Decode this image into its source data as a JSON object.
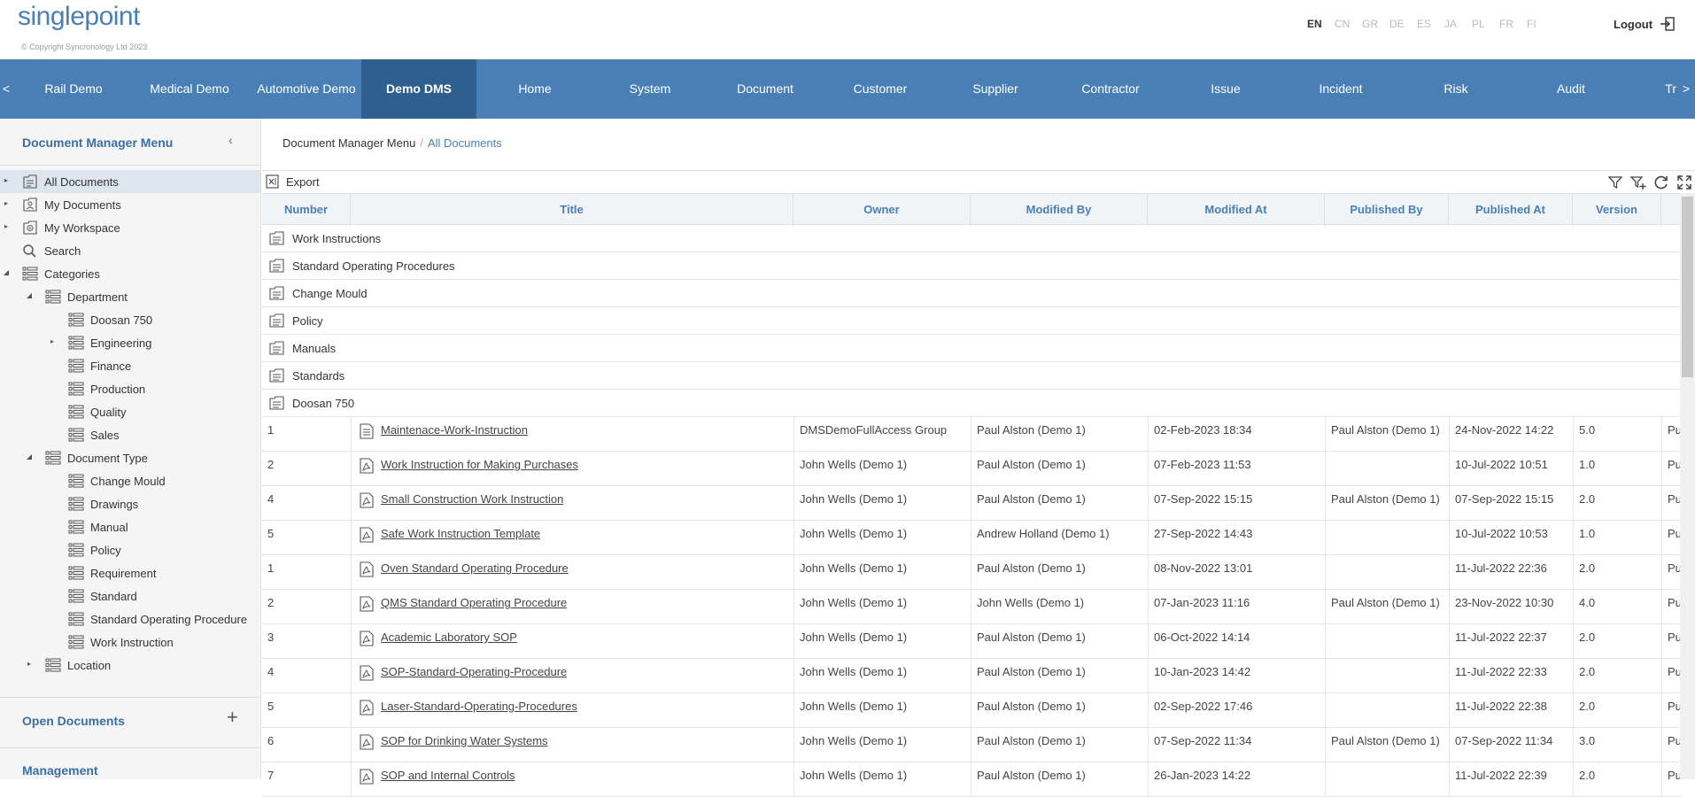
{
  "header": {
    "logo": "singlepoint",
    "copyright": "© Copyright Syncronology Ltd 2023",
    "languages": [
      "EN",
      "CN",
      "GR",
      "DE",
      "ES",
      "JA",
      "PL",
      "FR",
      "FI"
    ],
    "active_language": "EN",
    "logout_label": "Logout"
  },
  "nav": {
    "prev": "<",
    "next": ">",
    "items": [
      "Rail Demo",
      "Medical Demo",
      "Automotive Demo",
      "Demo DMS",
      "Home",
      "System",
      "Document",
      "Customer",
      "Supplier",
      "Contractor",
      "Issue",
      "Incident",
      "Risk",
      "Audit",
      "Tr"
    ],
    "active": "Demo DMS"
  },
  "sidebar": {
    "title": "Document Manager Menu",
    "collapse": "‹",
    "tree": [
      {
        "label": "All Documents",
        "toggle": "▸",
        "icon": "folder-list-icon",
        "selected": true
      },
      {
        "label": "My Documents",
        "toggle": "▸",
        "icon": "person-doc-icon"
      },
      {
        "label": "My Workspace",
        "toggle": "▸",
        "icon": "workspace-doc-icon"
      },
      {
        "label": "Search",
        "toggle": "",
        "icon": "search-icon"
      },
      {
        "label": "Categories",
        "toggle": "◢",
        "icon": "list-icon"
      },
      {
        "label": "Department",
        "toggle": "◢",
        "icon": "list-icon"
      },
      {
        "label": "Doosan 750",
        "toggle": "",
        "icon": "list-icon"
      },
      {
        "label": "Engineering",
        "toggle": "▸",
        "icon": "list-icon"
      },
      {
        "label": "Finance",
        "toggle": "",
        "icon": "list-icon"
      },
      {
        "label": "Production",
        "toggle": "",
        "icon": "list-icon"
      },
      {
        "label": "Quality",
        "toggle": "",
        "icon": "list-icon"
      },
      {
        "label": "Sales",
        "toggle": "",
        "icon": "list-icon"
      },
      {
        "label": "Document Type",
        "toggle": "◢",
        "icon": "list-icon"
      },
      {
        "label": "Change Mould",
        "toggle": "",
        "icon": "list-icon"
      },
      {
        "label": "Drawings",
        "toggle": "",
        "icon": "list-icon"
      },
      {
        "label": "Manual",
        "toggle": "",
        "icon": "list-icon"
      },
      {
        "label": "Policy",
        "toggle": "",
        "icon": "list-icon"
      },
      {
        "label": "Requirement",
        "toggle": "",
        "icon": "list-icon"
      },
      {
        "label": "Standard",
        "toggle": "",
        "icon": "list-icon"
      },
      {
        "label": "Standard Operating Procedure",
        "toggle": "",
        "icon": "list-icon"
      },
      {
        "label": "Work Instruction",
        "toggle": "",
        "icon": "list-icon"
      },
      {
        "label": "Location",
        "toggle": "▸",
        "icon": "list-icon"
      }
    ],
    "open_documents": "Open Documents",
    "add": "+",
    "management": "Management"
  },
  "breadcrumb": {
    "root": "Document Manager Menu",
    "separator": "/",
    "current": "All Documents"
  },
  "toolbar": {
    "export": "Export"
  },
  "grid": {
    "columns": [
      "Number",
      "Title",
      "Owner",
      "Modified By",
      "Modified At",
      "Published By",
      "Published At",
      "Version"
    ],
    "folders": [
      "Work Instructions",
      "Standard Operating Procedures",
      "Change Mould",
      "Policy",
      "Manuals",
      "Standards",
      "Doosan 750"
    ],
    "rows": [
      {
        "number": "1",
        "title": "Maintenace-Work-Instruction",
        "icon": "document-icon",
        "owner": "DMSDemoFullAccess Group",
        "modified_by": "Paul Alston (Demo 1)",
        "modified_at": "02-Feb-2023 18:34",
        "published_by": "Paul Alston (Demo 1)",
        "published_at": "24-Nov-2022 14:22",
        "version": "5.0",
        "status": "Pu"
      },
      {
        "number": "2",
        "title": "Work Instruction for Making Purchases",
        "icon": "pdf-icon",
        "owner": "John Wells (Demo 1)",
        "modified_by": "Paul Alston (Demo 1)",
        "modified_at": "07-Feb-2023 11:53",
        "published_by": "",
        "published_at": "10-Jul-2022 10:51",
        "version": "1.0",
        "status": "Pu"
      },
      {
        "number": "4",
        "title": "Small Construction Work Instruction",
        "icon": "pdf-icon",
        "owner": "John Wells (Demo 1)",
        "modified_by": "Paul Alston (Demo 1)",
        "modified_at": "07-Sep-2022 15:15",
        "published_by": "Paul Alston (Demo 1)",
        "published_at": "07-Sep-2022 15:15",
        "version": "2.0",
        "status": "Pu"
      },
      {
        "number": "5",
        "title": "Safe Work Instruction Template",
        "icon": "pdf-icon",
        "owner": "John Wells (Demo 1)",
        "modified_by": "Andrew Holland (Demo 1)",
        "modified_at": "27-Sep-2022 14:43",
        "published_by": "",
        "published_at": "10-Jul-2022 10:53",
        "version": "1.0",
        "status": "Pu"
      },
      {
        "number": "1",
        "title": "Oven Standard Operating Procedure",
        "icon": "pdf-icon",
        "owner": "John Wells (Demo 1)",
        "modified_by": "Paul Alston (Demo 1)",
        "modified_at": "08-Nov-2022 13:01",
        "published_by": "",
        "published_at": "11-Jul-2022 22:36",
        "version": "2.0",
        "status": "Pu"
      },
      {
        "number": "2",
        "title": "QMS Standard Operating Procedure",
        "icon": "pdf-icon",
        "owner": "John Wells (Demo 1)",
        "modified_by": "John Wells (Demo 1)",
        "modified_at": "07-Jan-2023 11:16",
        "published_by": "Paul Alston (Demo 1)",
        "published_at": "23-Nov-2022 10:30",
        "version": "4.0",
        "status": "Pu"
      },
      {
        "number": "3",
        "title": "Academic Laboratory SOP",
        "icon": "pdf-icon",
        "owner": "John Wells (Demo 1)",
        "modified_by": "Paul Alston (Demo 1)",
        "modified_at": "06-Oct-2022 14:14",
        "published_by": "",
        "published_at": "11-Jul-2022 22:37",
        "version": "2.0",
        "status": "Pu"
      },
      {
        "number": "4",
        "title": "SOP-Standard-Operating-Procedure",
        "icon": "pdf-icon",
        "owner": "John Wells (Demo 1)",
        "modified_by": "Paul Alston (Demo 1)",
        "modified_at": "10-Jan-2023 14:42",
        "published_by": "",
        "published_at": "11-Jul-2022 22:33",
        "version": "2.0",
        "status": "Pu"
      },
      {
        "number": "5",
        "title": "Laser-Standard-Operating-Procedures",
        "icon": "pdf-icon",
        "owner": "John Wells (Demo 1)",
        "modified_by": "Paul Alston (Demo 1)",
        "modified_at": "02-Sep-2022 17:46",
        "published_by": "",
        "published_at": "11-Jul-2022 22:38",
        "version": "2.0",
        "status": "Pu"
      },
      {
        "number": "6",
        "title": "SOP for Drinking Water Systems",
        "icon": "pdf-icon",
        "owner": "John Wells (Demo 1)",
        "modified_by": "Paul Alston (Demo 1)",
        "modified_at": "07-Sep-2022 11:34",
        "published_by": "Paul Alston (Demo 1)",
        "published_at": "07-Sep-2022 11:34",
        "version": "3.0",
        "status": "Pu"
      },
      {
        "number": "7",
        "title": "SOP and Internal Controls",
        "icon": "pdf-icon",
        "owner": "John Wells (Demo 1)",
        "modified_by": "Paul Alston (Demo 1)",
        "modified_at": "26-Jan-2023 14:22",
        "published_by": "",
        "published_at": "11-Jul-2022 22:39",
        "version": "2.0",
        "status": "Pu"
      }
    ]
  },
  "colors": {
    "brand": "#4a7fb5",
    "nav_active": "#2e5f8f",
    "selected_row": "#dde5ee"
  }
}
